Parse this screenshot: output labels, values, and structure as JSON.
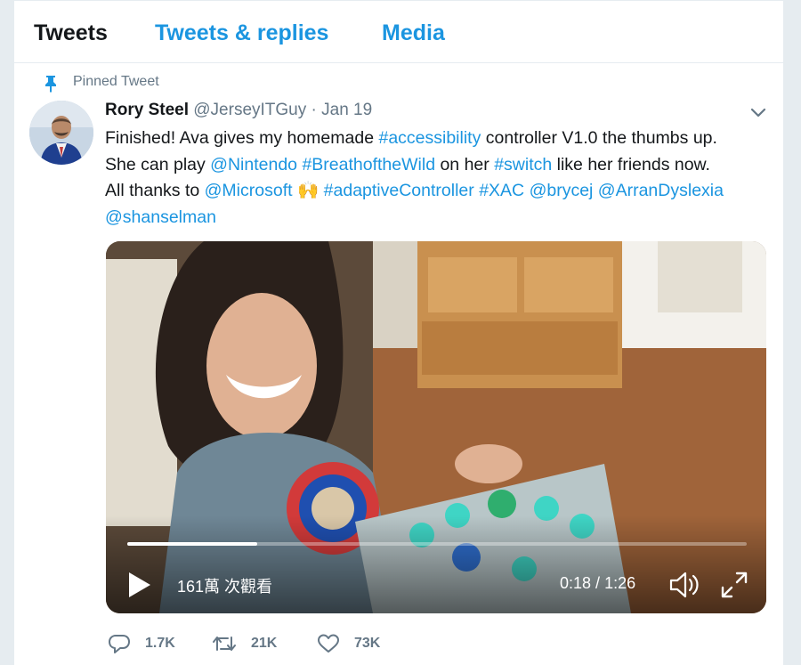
{
  "tabs": [
    {
      "label": "Tweets",
      "active": true
    },
    {
      "label": "Tweets & replies",
      "active": false
    },
    {
      "label": "Media",
      "active": false
    }
  ],
  "tweet": {
    "pinned_label": "Pinned Tweet",
    "author": {
      "name": "Rory Steel",
      "handle": "@JerseyITGuy",
      "separator": "·",
      "date": "Jan 19"
    },
    "text": {
      "line1": {
        "a": "Finished! Ava gives my homemade ",
        "b": "#accessibility",
        "c": " controller V1.0 the thumbs up."
      },
      "line2": {
        "a": "She can play ",
        "b": "@Nintendo",
        "c": " ",
        "d": "#BreathoftheWild",
        "e": " on her ",
        "f": "#switch",
        "g": " like her friends now."
      },
      "line3": {
        "a": "All thanks to ",
        "b": "@Microsoft",
        "emoji": "🙌",
        "c": "#adaptiveController",
        "d": "#XAC",
        "e": "@brycej",
        "f": "@ArranDyslexia"
      },
      "line4": {
        "a": "@shanselman"
      }
    },
    "video": {
      "views": "161萬 次觀看",
      "current_time": "0:18",
      "duration": "1:26",
      "time_separator": " / ",
      "progress": 0.21
    },
    "stats": {
      "replies": "1.7K",
      "retweets": "21K",
      "likes": "73K"
    }
  },
  "colors": {
    "link": "#1b95e0",
    "text": "#14171a",
    "muted": "#657786",
    "background": "#e6ecf0"
  },
  "icons": [
    "pin-icon",
    "caret-down-icon",
    "play-icon",
    "volume-icon",
    "fullscreen-icon",
    "reply-icon",
    "retweet-icon",
    "like-icon"
  ]
}
